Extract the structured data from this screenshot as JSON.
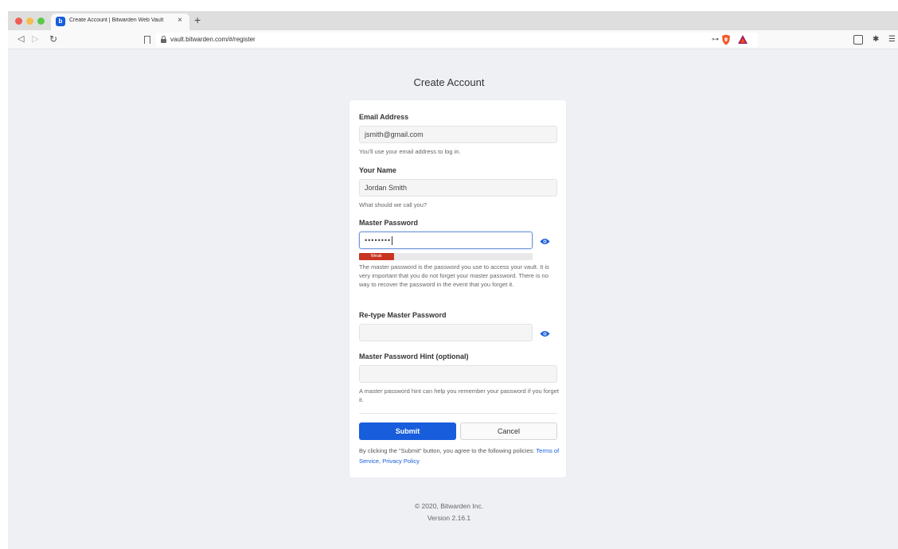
{
  "browser": {
    "tab_title": "Create Account | Bitwarden Web Vault",
    "tab_close": "×",
    "new_tab": "+",
    "url": "vault.bitwarden.com/#/register",
    "favicon_letter": "b"
  },
  "page": {
    "title": "Create Account"
  },
  "form": {
    "email": {
      "label": "Email Address",
      "value": "jsmith@gmail.com",
      "help": "You'll use your email address to log in."
    },
    "name": {
      "label": "Your Name",
      "value": "Jordan Smith",
      "help": "What should we call you?"
    },
    "master_password": {
      "label": "Master Password",
      "value": "••••••••",
      "strength_label": "Weak",
      "strength_fraction": 0.2,
      "help": "The master password is the password you use to access your vault. It is very important that you do not forget your master password. There is no way to recover the password in the event that you forget it."
    },
    "retype_password": {
      "label": "Re-type Master Password",
      "value": ""
    },
    "hint": {
      "label": "Master Password Hint (optional)",
      "value": "",
      "help": "A master password hint can help you remember your password if you forget it."
    },
    "submit_label": "Submit",
    "cancel_label": "Cancel",
    "policy_text": "By clicking the \"Submit\" button, you agree to the following policies: ",
    "terms_label": "Terms of Service",
    "policy_sep": ", ",
    "privacy_label": "Privacy Policy"
  },
  "footer": {
    "copyright": "© 2020, Bitwarden Inc.",
    "version": "Version 2.16.1"
  },
  "colors": {
    "primary": "#175ddc",
    "weak": "#c83522",
    "page_bg": "#eef0f4"
  }
}
